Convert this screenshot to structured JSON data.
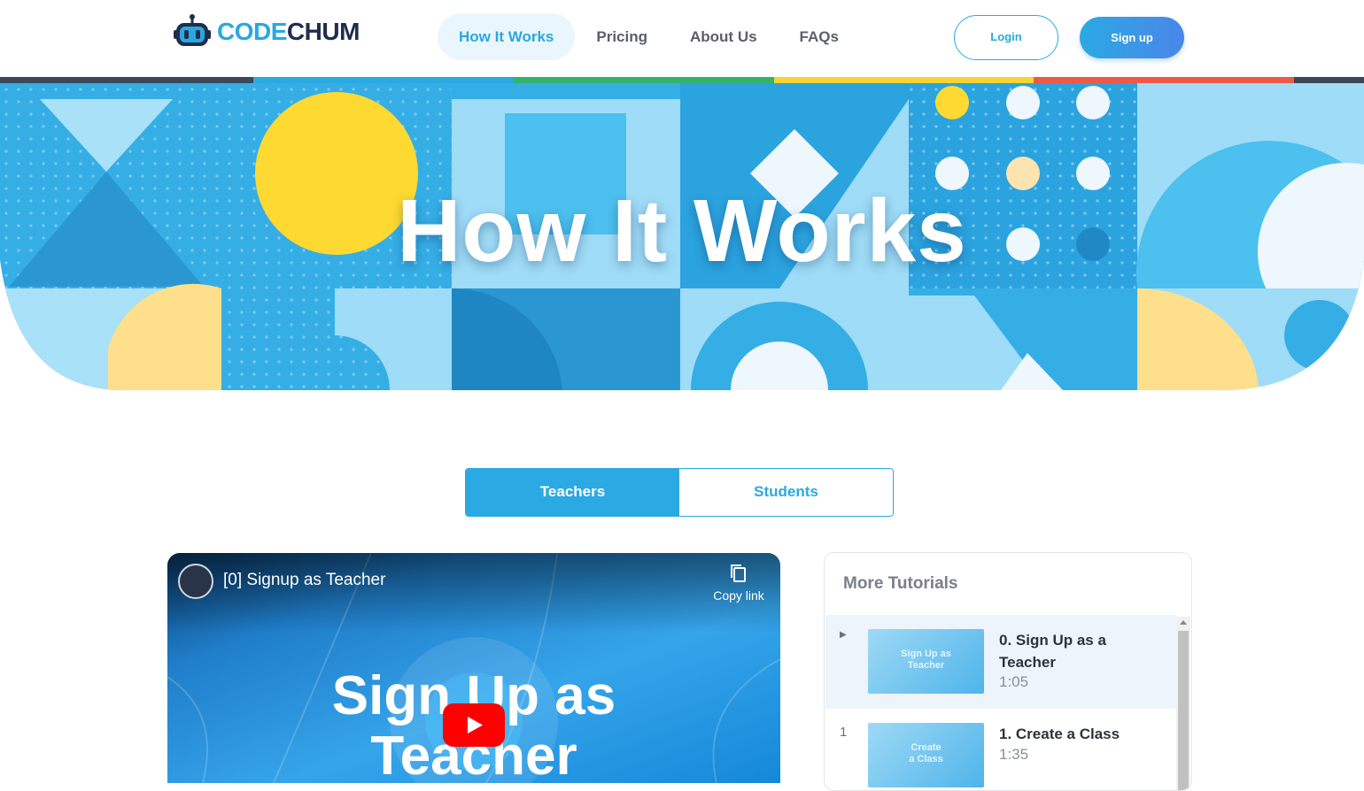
{
  "brand": {
    "part1": "CODE",
    "part2": "CHUM",
    "logo_icon": "robot-head-icon"
  },
  "nav": {
    "items": [
      {
        "label": "How It Works",
        "active": true
      },
      {
        "label": "Pricing",
        "active": false
      },
      {
        "label": "About Us",
        "active": false
      },
      {
        "label": "FAQs",
        "active": false
      }
    ],
    "login_label": "Login",
    "signup_label": "Sign up"
  },
  "hero": {
    "title": "How It Works"
  },
  "tabs": {
    "teachers": "Teachers",
    "students": "Students",
    "active": "teachers"
  },
  "video": {
    "title": "[0] Signup as Teacher",
    "copy_link": "Copy link",
    "big_text_line1": "Sign Up as",
    "big_text_line2": "Teacher",
    "play_icon": "youtube-play-icon",
    "copy_icon": "copy-icon"
  },
  "tutorials": {
    "heading": "More Tutorials",
    "items": [
      {
        "index": "▶",
        "thumb_text_1": "Sign Up as",
        "thumb_text_2": "Teacher",
        "title": "0. Sign Up as a Teacher",
        "duration": "1:05",
        "active": true
      },
      {
        "index": "1",
        "thumb_text_1": "Create",
        "thumb_text_2": "a Class",
        "title": "1. Create a Class",
        "duration": "1:35",
        "active": false
      }
    ]
  },
  "colors": {
    "accent": "#2ba9e2",
    "stripe_dark": "#3c4757",
    "stripe_blue": "#2ba9e2",
    "stripe_green": "#34b36b",
    "stripe_yellow": "#f6d433",
    "stripe_red": "#ee5a47"
  }
}
